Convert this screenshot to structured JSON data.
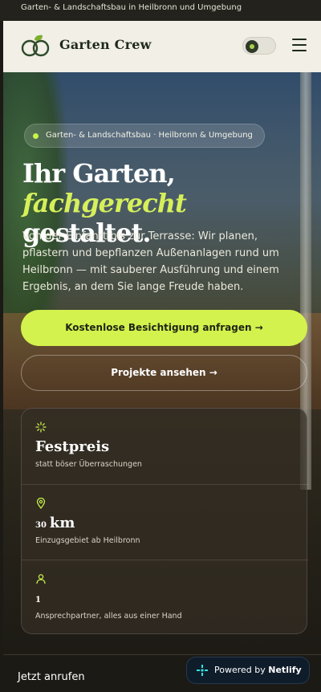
{
  "topbar": {
    "text": "Garten- & Landschaftsbau in Heilbronn und Umgebung"
  },
  "nav": {
    "brand": "Garten Crew",
    "menu_icon": "hamburger-icon",
    "theme_toggle_icon": "leaf-icon"
  },
  "hero": {
    "pill": "Garten- & Landschaftsbau · Heilbronn & Umgebung",
    "title_line1": "Ihr Garten,",
    "title_highlight": "fachgerecht",
    "title_rest": " gestaltet.",
    "lead": "Von der Einfahrt bis zur Terrasse: Wir planen, pflastern und bepflanzen Außenanlagen rund um Heilbronn — mit sauberer Ausführung und einem Ergebnis, an dem Sie lange Freude haben.",
    "primary_cta": "Kostenlose Besichtigung anfragen →",
    "secondary_cta": "Projekte ansehen →"
  },
  "stats": [
    {
      "icon": "sparkle-icon",
      "prefix": "",
      "value": "Festpreis",
      "label": "statt böser Überraschungen"
    },
    {
      "icon": "location-pin-icon",
      "prefix": "30",
      "value": "km",
      "label": "Einzugsgebiet ab Heilbronn"
    },
    {
      "icon": "person-icon",
      "prefix": "1",
      "value": "",
      "label": "Ansprechpartner, alles aus einer Hand"
    }
  ],
  "bottombar": {
    "call": "Jetzt anrufen"
  },
  "netlify": {
    "prefix": "Powered by ",
    "brand": "Netlify"
  },
  "colors": {
    "accent": "#d4f24d",
    "nav_bg": "#f1efe6",
    "brand_text": "#1f2a1d"
  }
}
